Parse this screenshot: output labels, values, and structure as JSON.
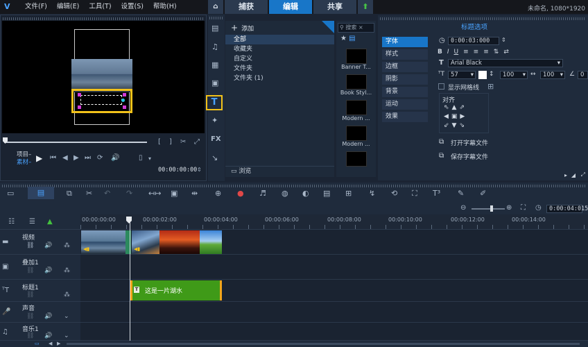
{
  "menu": [
    "文件(F)",
    "编辑(E)",
    "工具(T)",
    "设置(S)",
    "帮助(H)"
  ],
  "tabs": [
    "捕获",
    "编辑",
    "共享"
  ],
  "project_info": "未命名, 1080*1920",
  "preview": {
    "mode_project": "项目–",
    "mode_clip": "素材–",
    "timecode": "00:00:00:00"
  },
  "library": {
    "add_label": "添加",
    "items": [
      "全部",
      "收藏夹",
      "自定义",
      "文件夹",
      "文件夹 (1)"
    ],
    "browse_label": "浏览",
    "search_placeholder": "搜索",
    "thumbs": [
      "Banner T...",
      "Book Styl...",
      "Modern ...",
      "Modern ...",
      ""
    ]
  },
  "options": {
    "title": "标题选项",
    "tabs": [
      "字体",
      "样式",
      "边框",
      "阴影",
      "背景",
      "运动",
      "效果"
    ],
    "duration": "0:00:03:000",
    "font_name": "Arial Black",
    "font_size": "57",
    "line_spacing": "100",
    "char_spacing": "100",
    "show_grid_label": "显示网格线",
    "align_label": "对齐",
    "open_subtitle": "打开字幕文件",
    "save_subtitle": "保存字幕文件",
    "rotate_value": "0"
  },
  "timeline": {
    "zoom_timecode": "0:00:04:015",
    "ruler": [
      "00:00:00:00",
      "00:00:02:00",
      "00:00:04:00",
      "00:00:06:00",
      "00:00:08:00",
      "00:00:10:00",
      "00:00:12:00",
      "00:00:14:00"
    ],
    "tracks": [
      "视频",
      "叠加1",
      "标题1",
      "声音",
      "音乐1"
    ],
    "title_clip_text": "这是一片湖水"
  },
  "colors": {
    "accent": "#1876c8",
    "title_clip": "#3f9a18",
    "highlight": "#f2c21a"
  }
}
